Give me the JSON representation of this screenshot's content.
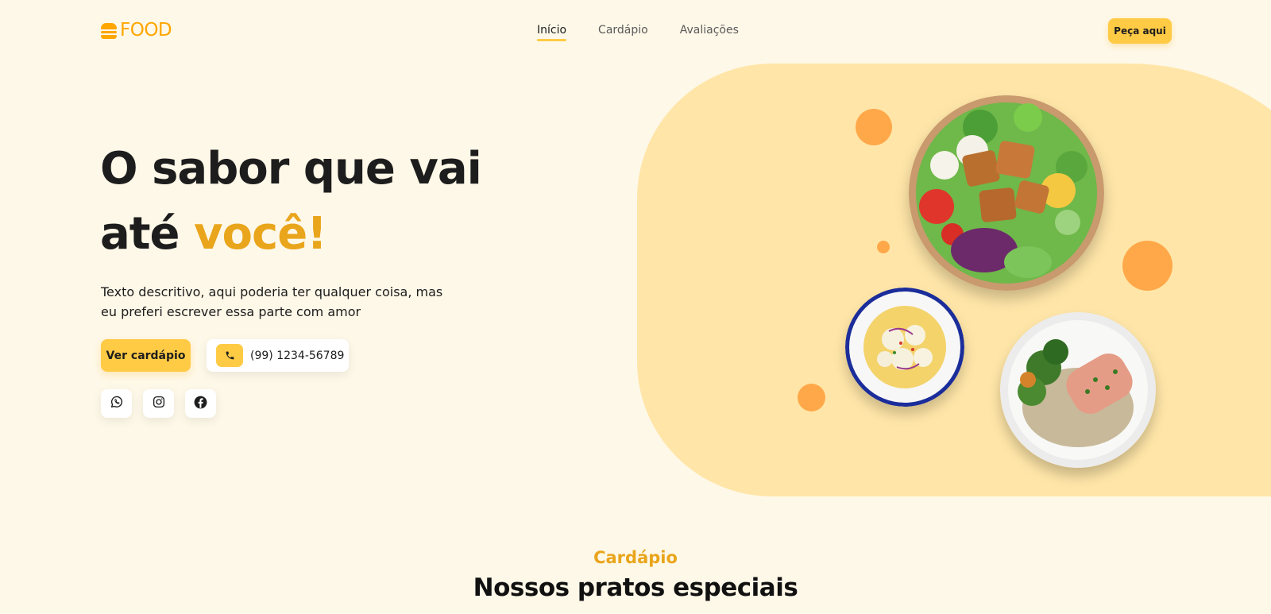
{
  "header": {
    "logo_text": "FOOD",
    "nav": [
      {
        "label": "Início",
        "active": true
      },
      {
        "label": "Cardápio",
        "active": false
      },
      {
        "label": "Avaliações",
        "active": false
      }
    ],
    "cta_label": "Peça aqui"
  },
  "hero": {
    "title_line1": "O sabor que vai",
    "title_line2_prefix": "até ",
    "title_line2_accent": "você!",
    "description": "Texto descritivo, aqui poderia ter qualquer coisa, mas eu preferi escrever essa parte com amor",
    "menu_button_label": "Ver cardápio",
    "phone_number": "(99) 1234-56789",
    "social_icons": [
      "whatsapp-icon",
      "instagram-icon",
      "facebook-icon"
    ]
  },
  "section": {
    "tag": "Cardápio",
    "title": "Nossos pratos especiais"
  },
  "colors": {
    "background": "#fef8e8",
    "primary": "#ffcb45",
    "accent_text": "#e9a51b",
    "hero_shape": "#ffe6a8",
    "dots": "#ffa84a"
  }
}
